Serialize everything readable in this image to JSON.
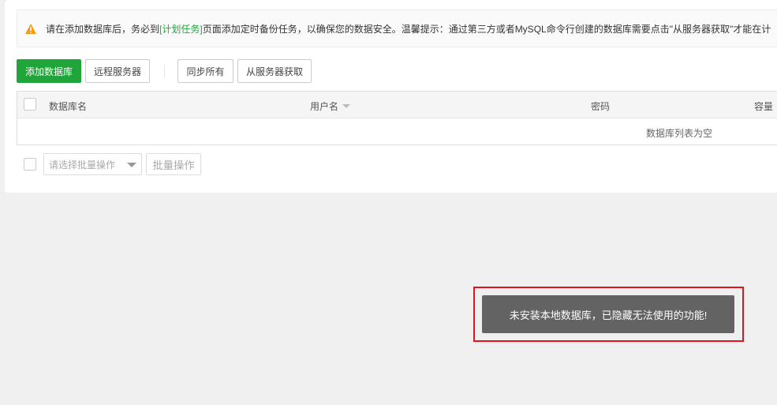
{
  "notice": {
    "icon": "warning-icon",
    "text_before": "请在添加数据库后，务必到",
    "link": "[计划任务]",
    "text_after": "页面添加定时备份任务，以确保您的数据安全。温馨提示：通过第三方或者MySQL命令行创建的数据库需要点击\"从服务器获取\"才能在计"
  },
  "toolbar": {
    "add_database": "添加数据库",
    "remote_server": "远程服务器",
    "sync_all": "同步所有",
    "fetch_from_server": "从服务器获取"
  },
  "table": {
    "columns": [
      "数据库名",
      "用户名",
      "密码",
      "容量"
    ],
    "empty_text": "数据库列表为空"
  },
  "batch": {
    "select_placeholder": "请选择批量操作",
    "button": "批量操作"
  },
  "toast": {
    "message": "未安装本地数据库，已隐藏无法使用的功能!"
  },
  "colors": {
    "accent": "#20a53a",
    "toast_bg": "#636363",
    "highlight": "#e8121e",
    "warning": "#f39c12"
  }
}
